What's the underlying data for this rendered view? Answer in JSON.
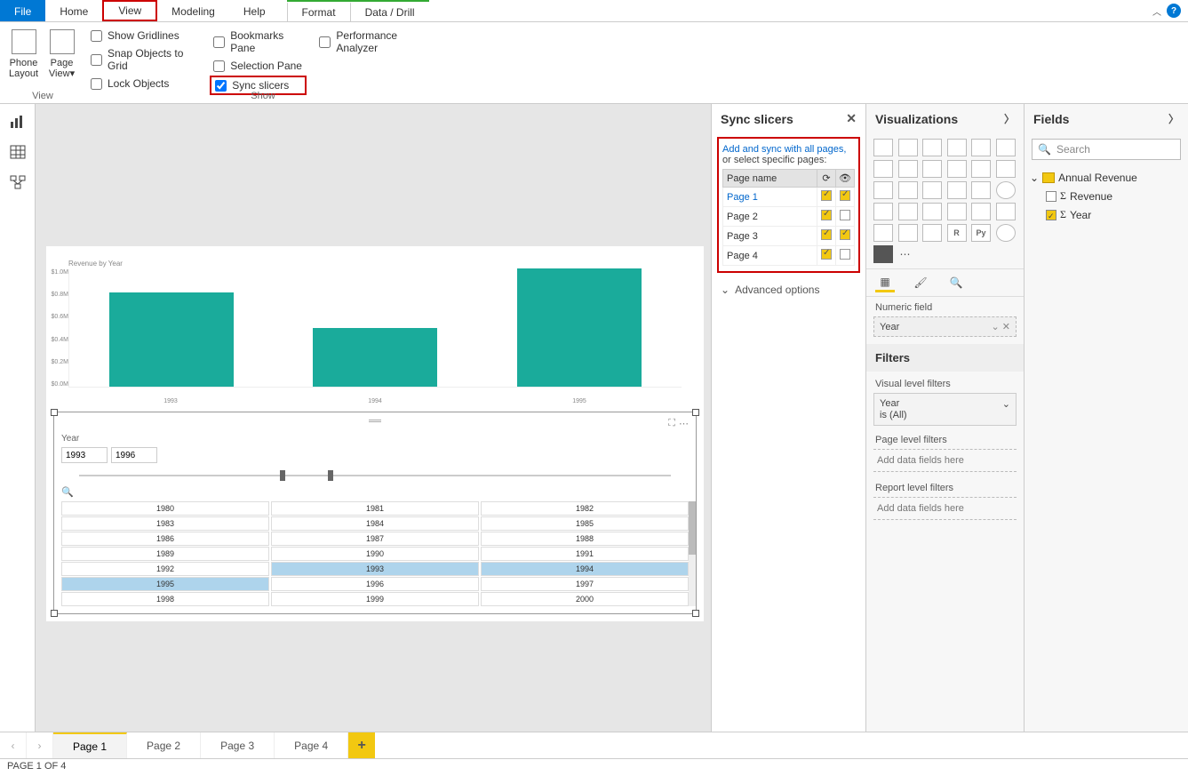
{
  "menu": {
    "file": "File",
    "home": "Home",
    "view": "View",
    "modeling": "Modeling",
    "help": "Help",
    "format": "Format",
    "datadrill": "Data / Drill"
  },
  "ribbon": {
    "phone": "Phone Layout",
    "page": "Page View",
    "viewGroup": "View",
    "showGroup": "Show",
    "gridlines": "Show Gridlines",
    "snap": "Snap Objects to Grid",
    "lock": "Lock Objects",
    "bookmarks": "Bookmarks Pane",
    "selection": "Selection Pane",
    "sync": "Sync slicers",
    "perf": "Performance Analyzer"
  },
  "syncPane": {
    "title": "Sync slicers",
    "link": "Add and sync with all pages",
    "sub": "or select specific pages:",
    "colPage": "Page name",
    "rows": [
      {
        "name": "Page 1",
        "sync": true,
        "vis": true,
        "active": true
      },
      {
        "name": "Page 2",
        "sync": true,
        "vis": false
      },
      {
        "name": "Page 3",
        "sync": true,
        "vis": true
      },
      {
        "name": "Page 4",
        "sync": true,
        "vis": false
      }
    ],
    "advanced": "Advanced options"
  },
  "vizPane": {
    "title": "Visualizations",
    "numeric": "Numeric field",
    "field": "Year",
    "filters": "Filters",
    "vlf": "Visual level filters",
    "yearFilter": "Year",
    "isAll": "is (All)",
    "plf": "Page level filters",
    "rlf": "Report level filters",
    "drop": "Add data fields here"
  },
  "fieldsPane": {
    "title": "Fields",
    "search": "Search",
    "table": "Annual Revenue",
    "f1": "Revenue",
    "f2": "Year"
  },
  "chart_data": {
    "type": "bar",
    "title": "Revenue by Year",
    "categories": [
      "1993",
      "1994",
      "1995"
    ],
    "values": [
      0.8,
      0.5,
      1.0
    ],
    "ylabel": "",
    "yticks": [
      "$1.0M",
      "$0.8M",
      "$0.6M",
      "$0.4M",
      "$0.2M",
      "$0.0M"
    ],
    "ylim": [
      0,
      1.0
    ]
  },
  "slicer": {
    "title": "Year",
    "from": "1993",
    "to": "1996",
    "grid": [
      [
        "1980",
        "1981",
        "1982"
      ],
      [
        "1983",
        "1984",
        "1985"
      ],
      [
        "1986",
        "1987",
        "1988"
      ],
      [
        "1989",
        "1990",
        "1991"
      ],
      [
        "1992",
        "1993",
        "1994"
      ],
      [
        "1995",
        "1996",
        "1997"
      ],
      [
        "1998",
        "1999",
        "2000"
      ]
    ],
    "selected": [
      "1993",
      "1994",
      "1995"
    ]
  },
  "pages": {
    "p1": "Page 1",
    "p2": "Page 2",
    "p3": "Page 3",
    "p4": "Page 4"
  },
  "status": "PAGE 1 OF 4"
}
